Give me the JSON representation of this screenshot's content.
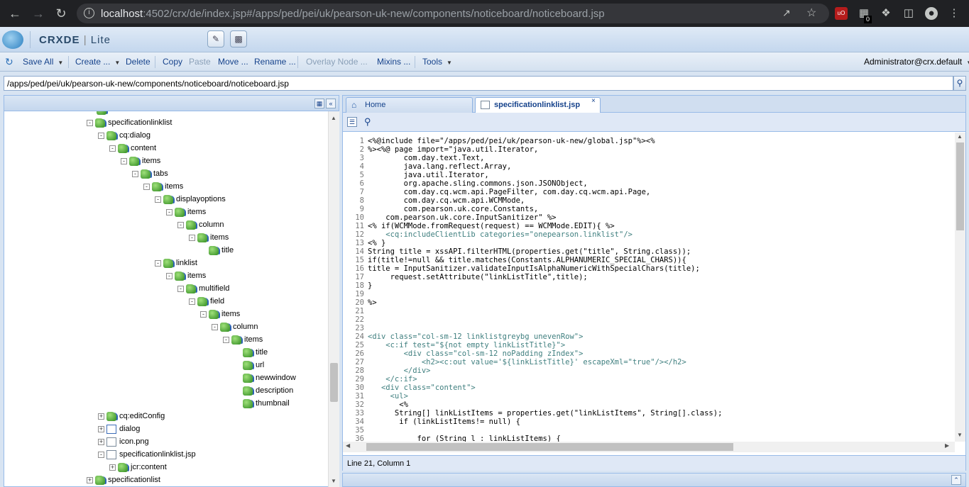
{
  "browser": {
    "url_host": "localhost",
    "url_rest": ":4502/crx/de/index.jsp#/apps/ped/pei/uk/pearson-uk-new/components/noticeboard/noticeboard.jsp",
    "ext_badge": "0"
  },
  "app": {
    "title_bold": "CRXDE",
    "title_light": "Lite"
  },
  "toolbar": {
    "save_all": "Save All",
    "create": "Create ...",
    "delete": "Delete",
    "copy": "Copy",
    "paste": "Paste",
    "move": "Move ...",
    "rename": "Rename ...",
    "overlay": "Overlay Node ...",
    "mixins": "Mixins ...",
    "tools": "Tools",
    "user": "Administrator@crx.default"
  },
  "path": "/apps/ped/pei/uk/pearson-uk-new/components/noticeboard/noticeboard.jsp",
  "tree": [
    {
      "label": "specificationlinklist",
      "depth": 0,
      "toggle": "-",
      "icon": "node"
    },
    {
      "label": "cq:dialog",
      "depth": 1,
      "toggle": "-",
      "icon": "node"
    },
    {
      "label": "content",
      "depth": 2,
      "toggle": "-",
      "icon": "node"
    },
    {
      "label": "items",
      "depth": 3,
      "toggle": "-",
      "icon": "node"
    },
    {
      "label": "tabs",
      "depth": 4,
      "toggle": "-",
      "icon": "node"
    },
    {
      "label": "items",
      "depth": 5,
      "toggle": "-",
      "icon": "node"
    },
    {
      "label": "displayoptions",
      "depth": 6,
      "toggle": "-",
      "icon": "node"
    },
    {
      "label": "items",
      "depth": 7,
      "toggle": "-",
      "icon": "node"
    },
    {
      "label": "column",
      "depth": 8,
      "toggle": "-",
      "icon": "node"
    },
    {
      "label": "items",
      "depth": 9,
      "toggle": "-",
      "icon": "node"
    },
    {
      "label": "title",
      "depth": 10,
      "toggle": "",
      "icon": "node"
    },
    {
      "label": "linklist",
      "depth": 6,
      "toggle": "-",
      "icon": "node"
    },
    {
      "label": "items",
      "depth": 7,
      "toggle": "-",
      "icon": "node"
    },
    {
      "label": "multifield",
      "depth": 8,
      "toggle": "-",
      "icon": "node"
    },
    {
      "label": "field",
      "depth": 9,
      "toggle": "-",
      "icon": "node"
    },
    {
      "label": "items",
      "depth": 10,
      "toggle": "-",
      "icon": "node"
    },
    {
      "label": "column",
      "depth": 11,
      "toggle": "-",
      "icon": "node"
    },
    {
      "label": "items",
      "depth": 12,
      "toggle": "-",
      "icon": "node"
    },
    {
      "label": "title",
      "depth": 13,
      "toggle": "",
      "icon": "node"
    },
    {
      "label": "url",
      "depth": 13,
      "toggle": "",
      "icon": "node"
    },
    {
      "label": "newwindow",
      "depth": 13,
      "toggle": "",
      "icon": "node"
    },
    {
      "label": "description",
      "depth": 13,
      "toggle": "",
      "icon": "node"
    },
    {
      "label": "thumbnail",
      "depth": 13,
      "toggle": "",
      "icon": "node"
    },
    {
      "label": "cq:editConfig",
      "depth": 1,
      "toggle": "+",
      "icon": "node"
    },
    {
      "label": "dialog",
      "depth": 1,
      "toggle": "+",
      "icon": "folder"
    },
    {
      "label": "icon.png",
      "depth": 1,
      "toggle": "+",
      "icon": "file"
    },
    {
      "label": "specificationlinklist.jsp",
      "depth": 1,
      "toggle": "-",
      "icon": "file"
    },
    {
      "label": "jcr:content",
      "depth": 2,
      "toggle": "+",
      "icon": "node"
    },
    {
      "label": "specificationlist",
      "depth": 0,
      "toggle": "+",
      "icon": "node"
    }
  ],
  "tabs": [
    {
      "label": "Home"
    },
    {
      "label": "specificationlinklist.jsp"
    }
  ],
  "code": [
    "<%@include file=\"/apps/ped/pei/uk/pearson-uk-new/global.jsp\"%><%",
    "%><%@ page import=\"java.util.Iterator,",
    "        com.day.text.Text,",
    "        java.lang.reflect.Array,",
    "        java.util.Iterator,",
    "        org.apache.sling.commons.json.JSONObject,",
    "        com.day.cq.wcm.api.PageFilter, com.day.cq.wcm.api.Page,",
    "        com.day.cq.wcm.api.WCMMode,",
    "        com.pearson.uk.core.Constants,",
    "    com.pearson.uk.core.InputSanitizer\" %>",
    "<% if(WCMMode.fromRequest(request) == WCMMode.EDIT){ %>",
    "    <cq:includeClientLib categories=\"onepearson.linklist\"/>",
    "<% }",
    "String title = xssAPI.filterHTML(properties.get(\"title\", String.class));",
    "if(title!=null && title.matches(Constants.ALPHANUMERIC_SPECIAL_CHARS)){",
    "title = InputSanitizer.validateInputIsAlphaNumericWithSpecialChars(title);",
    "     request.setAttribute(\"linkListTitle\",title);",
    "}",
    "",
    "%>",
    "",
    "",
    "",
    "<div class=\"col-sm-12 linklistgreybg unevenRow\">",
    "    <c:if test=\"${not empty linkListTitle}\">",
    "        <div class=\"col-sm-12 noPadding zIndex\">",
    "            <h2><c:out value='${linkListTitle}' escapeXml=\"true\"/></h2>",
    "        </div>",
    "    </c:if>",
    "   <div class=\"content\">",
    "     <ul>",
    "       <%",
    "      String[] linkListItems = properties.get(\"linkListItems\", String[].class);",
    "       if (linkListItems!= null) {",
    "",
    "           for (String l : linkListItems) {"
  ],
  "status": "Line 21, Column 1"
}
